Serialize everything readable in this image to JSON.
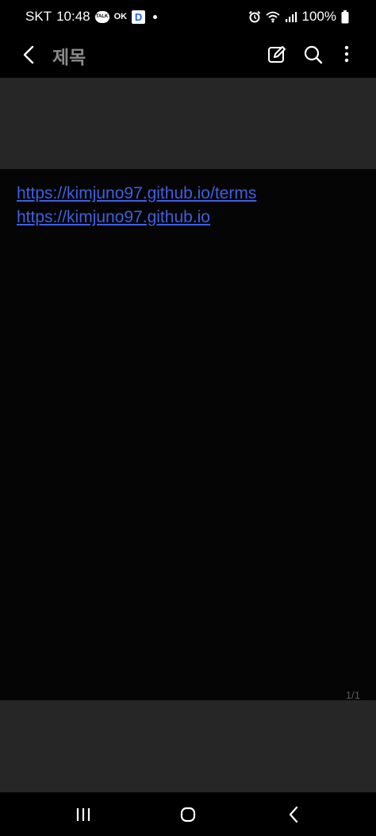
{
  "status_bar": {
    "carrier": "SKT",
    "time": "10:48",
    "notification_icons": [
      "kakaotalk-icon",
      "ok-cashbag-icon",
      "d-app-icon",
      "more-dot-icon"
    ],
    "talk_text": "TALK",
    "ok_text": "OK",
    "d_text": "D",
    "system_icons": [
      "alarm-icon",
      "wifi-icon",
      "signal-icon",
      "battery-icon"
    ],
    "battery": "100%"
  },
  "app_bar": {
    "title": "제목",
    "actions": [
      "edit-icon",
      "search-icon",
      "more-vertical-icon"
    ]
  },
  "note": {
    "links": [
      "https://kimjuno97.github.io/terms",
      "https://kimjuno97.github.io"
    ],
    "page_indicator": "1/1"
  },
  "colors": {
    "background": "#050505",
    "band": "#262626",
    "link": "#3f5fe0",
    "title": "#8a8a8a"
  },
  "nav_bar": {
    "buttons": [
      "recents-icon",
      "home-icon",
      "back-icon"
    ]
  }
}
